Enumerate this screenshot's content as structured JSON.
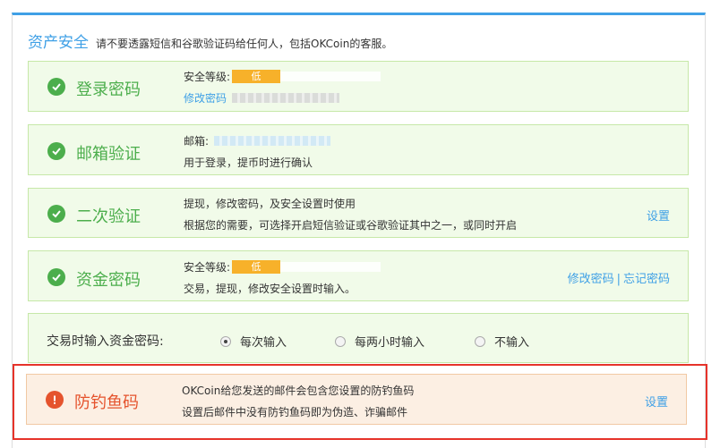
{
  "header": {
    "title": "资产安全",
    "note": "请不要透露短信和谷歌验证码给任何人，包括OKCoin的客服。"
  },
  "login_password": {
    "name": "登录密码",
    "level_label": "安全等级:",
    "level": "低",
    "change_link": "修改密码"
  },
  "email": {
    "name": "邮箱验证",
    "email_label": "邮箱:",
    "desc": "用于登录，提币时进行确认"
  },
  "two_factor": {
    "name": "二次验证",
    "line1": "提现，修改密码，及安全设置时使用",
    "line2": "根据您的需要，可选择开启短信验证或谷歌验证其中之一，或同时开启",
    "action": "设置"
  },
  "fund_password": {
    "name": "资金密码",
    "level_label": "安全等级:",
    "level": "低",
    "desc": "交易，提现，修改安全设置时输入。",
    "change_link": "修改密码",
    "separator": "|",
    "forgot_link": "忘记密码"
  },
  "trade_input": {
    "label": "交易时输入资金密码:",
    "options": [
      "每次输入",
      "每两小时输入",
      "不输入"
    ],
    "selected": "每次输入"
  },
  "anti_phishing": {
    "name": "防钓鱼码",
    "line1": "OKCoin给您发送的邮件会包含您设置的防钓鱼码",
    "line2": "设置后邮件中没有防钓鱼码即为伪造、诈骗邮件",
    "action": "设置"
  },
  "colors": {
    "accent": "#3fa0e6",
    "success": "#4cae4c",
    "warning": "#e5532d",
    "level_low": "#f7b12a",
    "highlight_border": "#e6332a"
  }
}
